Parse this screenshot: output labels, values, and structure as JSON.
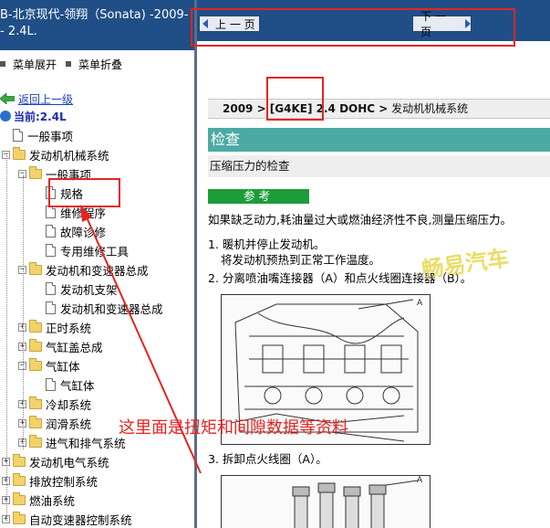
{
  "left_panel": {
    "header_title": "B-北京现代-领翔（Sonata) -2009-\n- 2.4L.",
    "menu": {
      "expand_label": "菜单展开",
      "collapse_label": "菜单折叠"
    },
    "back_label": "返回上一级",
    "current_label": "当前:2.4L",
    "tree": [
      {
        "label": "一般事项",
        "level": 0,
        "type": "page",
        "expander": ""
      },
      {
        "label": "发动机机械系统",
        "level": 0,
        "type": "folder",
        "expander": "-"
      },
      {
        "label": "一般事项",
        "level": 1,
        "type": "folder",
        "expander": "-"
      },
      {
        "label": "规格",
        "level": 2,
        "type": "page",
        "expander": ""
      },
      {
        "label": "维修程序",
        "level": 2,
        "type": "page",
        "expander": ""
      },
      {
        "label": "故障诊修",
        "level": 2,
        "type": "page",
        "expander": ""
      },
      {
        "label": "专用维修工具",
        "level": 2,
        "type": "page",
        "expander": ""
      },
      {
        "label": "发动机和变速器总成",
        "level": 1,
        "type": "folder",
        "expander": "-"
      },
      {
        "label": "发动机支架",
        "level": 2,
        "type": "page",
        "expander": ""
      },
      {
        "label": "发动机和变速器总成",
        "level": 2,
        "type": "page",
        "expander": ""
      },
      {
        "label": "正时系统",
        "level": 1,
        "type": "folder",
        "expander": "+"
      },
      {
        "label": "气缸盖总成",
        "level": 1,
        "type": "folder",
        "expander": "+"
      },
      {
        "label": "气缸体",
        "level": 1,
        "type": "folder",
        "expander": "-"
      },
      {
        "label": "气缸体",
        "level": 2,
        "type": "page",
        "expander": ""
      },
      {
        "label": "冷却系统",
        "level": 1,
        "type": "folder",
        "expander": "+"
      },
      {
        "label": "润滑系统",
        "level": 1,
        "type": "folder",
        "expander": "+"
      },
      {
        "label": "进气和排气系统",
        "level": 1,
        "type": "folder",
        "expander": "+"
      },
      {
        "label": "发动机电气系统",
        "level": 0,
        "type": "folder",
        "expander": "+"
      },
      {
        "label": "排放控制系统",
        "level": 0,
        "type": "folder",
        "expander": "+"
      },
      {
        "label": "燃油系统",
        "level": 0,
        "type": "folder",
        "expander": "+"
      },
      {
        "label": "自动变速器控制系统",
        "level": 0,
        "type": "folder",
        "expander": "+"
      }
    ]
  },
  "right_panel": {
    "nav": {
      "prev_label": "上 一 页",
      "next_label": "下 一 页"
    },
    "breadcrumb_bold": "2009 > [G4KE] 2.4 DOHC >",
    "breadcrumb_tail": " 发动机机械系统",
    "section_title": "检查",
    "subtitle": "压缩压力的检查",
    "note_label": "参考",
    "note_text": "如果缺乏动力,耗油量过大或燃油经济性不良,测量压缩压力。",
    "steps": {
      "s1": "1. 暖机并停止发动机。",
      "s1b": "将发动机预热到正常工作温度。",
      "s2": "2. 分离喷油嘴连接器（A）和点火线圈连接器（B）。",
      "s3": "3. 拆卸点火线圈（A）。"
    },
    "figure_label_a": "A",
    "watermark": "畅易汽车"
  },
  "annotation": {
    "text": "这里面是扭矩和间隙数据等资料",
    "color": "#e52421"
  },
  "colors": {
    "header_blue": "#1f4f86",
    "section_teal": "#4caaa4",
    "note_green": "#1d9c3a",
    "link_blue": "#1a44b8"
  }
}
